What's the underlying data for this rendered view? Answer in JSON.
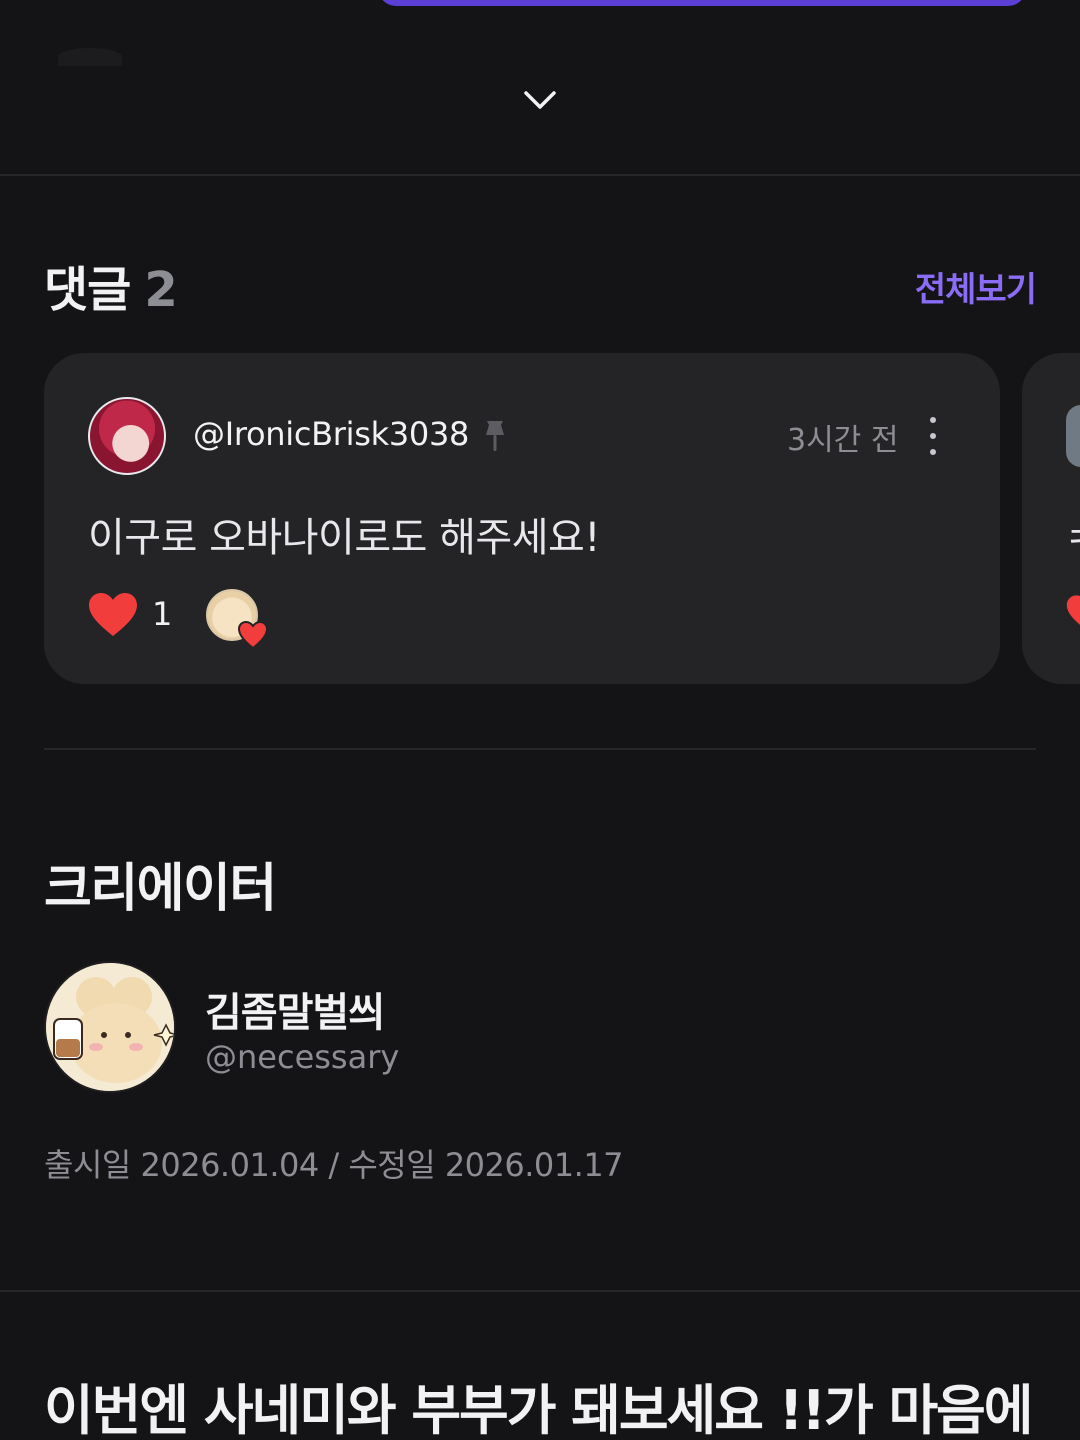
{
  "comments": {
    "title": "댓글",
    "count": "2",
    "view_all_label": "전체보기",
    "items": [
      {
        "username": "@IronicBrisk3038",
        "time": "3시간 전",
        "text": "이구로 오바나이로도 해주세요!",
        "likes": "1"
      }
    ],
    "peek_text": "ㅋ"
  },
  "creator": {
    "title": "크리에이터",
    "name": "김좀말벌씌",
    "handle": "@necessary",
    "release_dates": "출시일 2026.01.04 / 수정일 2026.01.17"
  },
  "next_section": {
    "title": "이번엔 사네미와 부부가 돼보세요 !!가 마음에"
  },
  "colors": {
    "accent": "#8b6cf6",
    "heart": "#f23d3d",
    "background": "#141416",
    "card": "#242427"
  },
  "icons": [
    "chevron-down-icon",
    "pin-icon",
    "more-vertical-icon",
    "heart-icon"
  ]
}
